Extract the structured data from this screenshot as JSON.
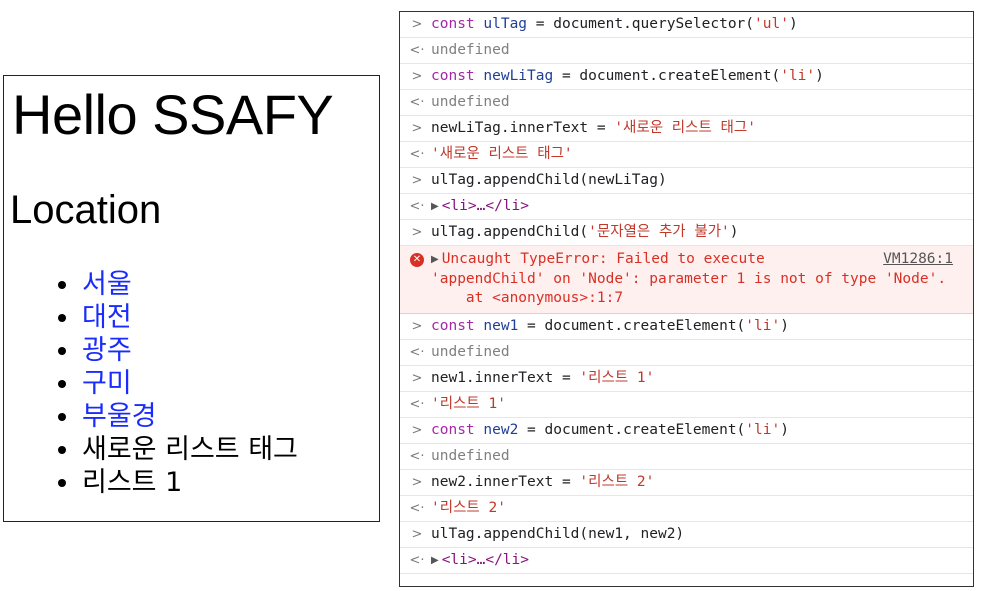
{
  "page": {
    "heading": "Hello SSAFY",
    "subheading": "Location",
    "list": [
      {
        "label": "서울",
        "link": true
      },
      {
        "label": "대전",
        "link": true
      },
      {
        "label": "광주",
        "link": true
      },
      {
        "label": "구미",
        "link": true
      },
      {
        "label": "부울경",
        "link": true
      },
      {
        "label": "새로운 리스트 태그",
        "link": false
      },
      {
        "label": "리스트 1",
        "link": false
      }
    ]
  },
  "console": {
    "input_prefix": ">",
    "output_prefix": "<·",
    "lines": {
      "l1_kw": "const",
      "l1_var": "ulTag",
      "l1_rest": " = document.querySelector(",
      "l1_str": "'ul'",
      "l1_close": ")",
      "l2": "undefined",
      "l3_kw": "const",
      "l3_var": "newLiTag",
      "l3_rest": " = document.createElement(",
      "l3_str": "'li'",
      "l3_close": ")",
      "l4": "undefined",
      "l5_code": "newLiTag.innerText = ",
      "l5_str": "'새로운 리스트 태그'",
      "l6": "'새로운 리스트 태그'",
      "l7": "ulTag.appendChild(newLiTag)",
      "l8_tag": "<li>…</li>",
      "l9_code": "ulTag.appendChild(",
      "l9_str": "'문자열은 추가 불가'",
      "l9_close": ")",
      "err1": "Uncaught TypeError: Failed to execute",
      "err2": "'appendChild' on 'Node': parameter 1 is not of type 'Node'.",
      "err3": "    at <anonymous>:1:7",
      "err_src": "VM1286:1",
      "l11_kw": "const",
      "l11_var": "new1",
      "l11_rest": " = document.createElement(",
      "l11_str": "'li'",
      "l11_close": ")",
      "l12": "undefined",
      "l13_code": "new1.innerText = ",
      "l13_str": "'리스트 1'",
      "l14": "'리스트 1'",
      "l15_kw": "const",
      "l15_var": "new2",
      "l15_rest": " = document.createElement(",
      "l15_str": "'li'",
      "l15_close": ")",
      "l16": "undefined",
      "l17_code": "new2.innerText = ",
      "l17_str": "'리스트 2'",
      "l18": "'리스트 2'",
      "l19": "ulTag.appendChild(new1, new2)",
      "l20_tag": "<li>…</li>"
    }
  }
}
